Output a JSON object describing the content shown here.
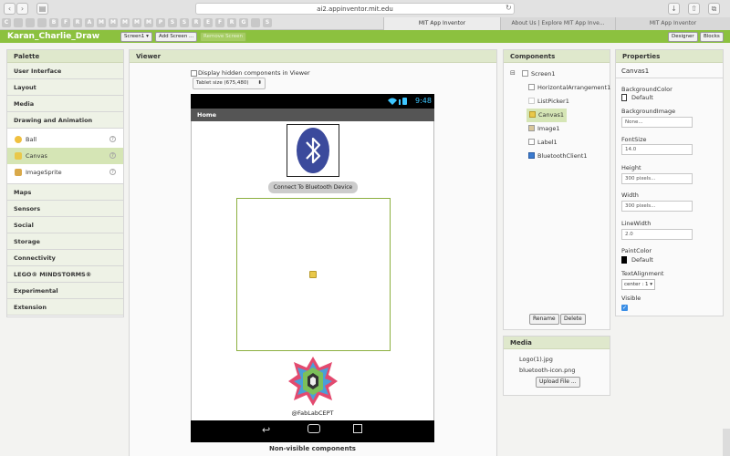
{
  "browser": {
    "url": "ai2.appinventor.mit.edu",
    "tabs": [
      "MIT App Inventor",
      "About Us | Explore MIT App Inve...",
      "MIT App Inventor"
    ],
    "favicons": [
      "C",
      "",
      "",
      "",
      "B",
      "F",
      "R",
      "A",
      "M",
      "M",
      "M",
      "M",
      "M",
      "P",
      "S",
      "S",
      "R",
      "E",
      "F",
      "R",
      "G",
      "",
      "S"
    ]
  },
  "app": {
    "project_title": "Karan_Charlie_Draw",
    "screen_button": "Screen1 ▾",
    "add_screen": "Add Screen ...",
    "remove_screen": "Remove Screen",
    "designer": "Designer",
    "blocks": "Blocks"
  },
  "palette": {
    "title": "Palette",
    "categories_top": [
      "User Interface",
      "Layout",
      "Media",
      "Drawing and Animation"
    ],
    "drawing_items": [
      "Ball",
      "Canvas",
      "ImageSprite"
    ],
    "categories_bottom": [
      "Maps",
      "Sensors",
      "Social",
      "Storage",
      "Connectivity",
      "LEGO® MINDSTORMS®",
      "Experimental",
      "Extension"
    ]
  },
  "viewer": {
    "title": "Viewer",
    "hidden_label": "Display hidden components in Viewer",
    "size_select": "Tablet size (675,480)",
    "clock": "9:48",
    "screen_title": "Home",
    "connect_button": "Connect To Bluetooth Device",
    "logo_caption": "@FabLabCEPT",
    "non_visible": "Non-visible components"
  },
  "components": {
    "title": "Components",
    "items": [
      "Screen1",
      "HorizontalArrangement1",
      "ListPicker1",
      "Canvas1",
      "Image1",
      "Label1",
      "BluetoothClient1"
    ],
    "rename": "Rename",
    "delete": "Delete"
  },
  "media": {
    "title": "Media",
    "files": [
      "Logo(1).jpg",
      "bluetooth-icon.png"
    ],
    "upload": "Upload File ..."
  },
  "properties": {
    "title": "Properties",
    "component": "Canvas1",
    "bg_color_label": "BackgroundColor",
    "bg_color_value": "Default",
    "bg_image_label": "BackgroundImage",
    "bg_image_value": "None...",
    "font_size_label": "FontSize",
    "font_size_value": "14.0",
    "height_label": "Height",
    "height_value": "300 pixels...",
    "width_label": "Width",
    "width_value": "300 pixels...",
    "line_width_label": "LineWidth",
    "line_width_value": "2.0",
    "paint_color_label": "PaintColor",
    "paint_color_value": "Default",
    "text_align_label": "TextAlignment",
    "text_align_value": "center : 1 ▾",
    "visible_label": "Visible"
  },
  "colors": {
    "accent": "#8cc13f",
    "bluetooth": "#3b4a9c"
  }
}
